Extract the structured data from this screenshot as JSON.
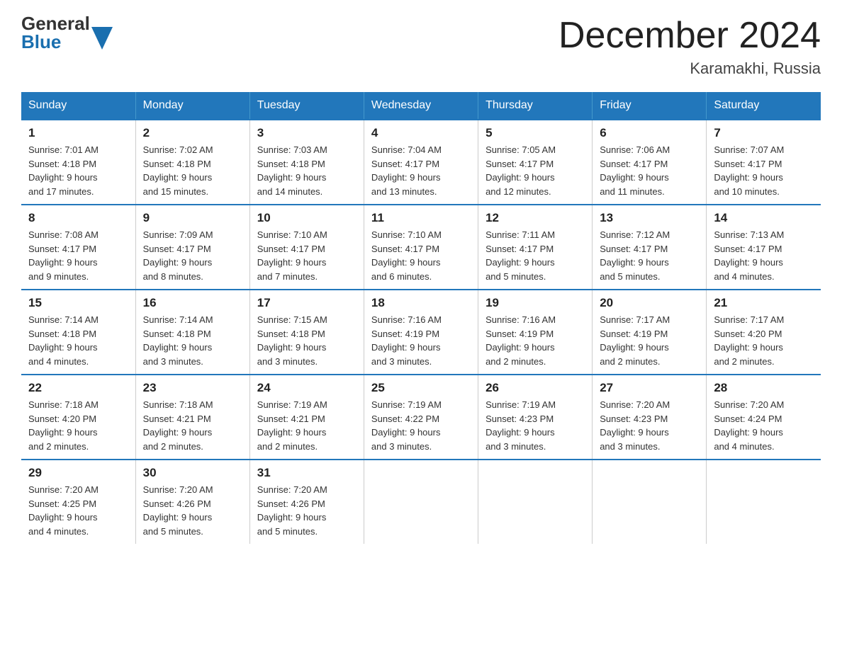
{
  "header": {
    "title": "December 2024",
    "subtitle": "Karamakhi, Russia",
    "logo_general": "General",
    "logo_blue": "Blue"
  },
  "days_of_week": [
    "Sunday",
    "Monday",
    "Tuesday",
    "Wednesday",
    "Thursday",
    "Friday",
    "Saturday"
  ],
  "weeks": [
    [
      {
        "num": "1",
        "sunrise": "7:01 AM",
        "sunset": "4:18 PM",
        "daylight": "9 hours and 17 minutes."
      },
      {
        "num": "2",
        "sunrise": "7:02 AM",
        "sunset": "4:18 PM",
        "daylight": "9 hours and 15 minutes."
      },
      {
        "num": "3",
        "sunrise": "7:03 AM",
        "sunset": "4:18 PM",
        "daylight": "9 hours and 14 minutes."
      },
      {
        "num": "4",
        "sunrise": "7:04 AM",
        "sunset": "4:17 PM",
        "daylight": "9 hours and 13 minutes."
      },
      {
        "num": "5",
        "sunrise": "7:05 AM",
        "sunset": "4:17 PM",
        "daylight": "9 hours and 12 minutes."
      },
      {
        "num": "6",
        "sunrise": "7:06 AM",
        "sunset": "4:17 PM",
        "daylight": "9 hours and 11 minutes."
      },
      {
        "num": "7",
        "sunrise": "7:07 AM",
        "sunset": "4:17 PM",
        "daylight": "9 hours and 10 minutes."
      }
    ],
    [
      {
        "num": "8",
        "sunrise": "7:08 AM",
        "sunset": "4:17 PM",
        "daylight": "9 hours and 9 minutes."
      },
      {
        "num": "9",
        "sunrise": "7:09 AM",
        "sunset": "4:17 PM",
        "daylight": "9 hours and 8 minutes."
      },
      {
        "num": "10",
        "sunrise": "7:10 AM",
        "sunset": "4:17 PM",
        "daylight": "9 hours and 7 minutes."
      },
      {
        "num": "11",
        "sunrise": "7:10 AM",
        "sunset": "4:17 PM",
        "daylight": "9 hours and 6 minutes."
      },
      {
        "num": "12",
        "sunrise": "7:11 AM",
        "sunset": "4:17 PM",
        "daylight": "9 hours and 5 minutes."
      },
      {
        "num": "13",
        "sunrise": "7:12 AM",
        "sunset": "4:17 PM",
        "daylight": "9 hours and 5 minutes."
      },
      {
        "num": "14",
        "sunrise": "7:13 AM",
        "sunset": "4:17 PM",
        "daylight": "9 hours and 4 minutes."
      }
    ],
    [
      {
        "num": "15",
        "sunrise": "7:14 AM",
        "sunset": "4:18 PM",
        "daylight": "9 hours and 4 minutes."
      },
      {
        "num": "16",
        "sunrise": "7:14 AM",
        "sunset": "4:18 PM",
        "daylight": "9 hours and 3 minutes."
      },
      {
        "num": "17",
        "sunrise": "7:15 AM",
        "sunset": "4:18 PM",
        "daylight": "9 hours and 3 minutes."
      },
      {
        "num": "18",
        "sunrise": "7:16 AM",
        "sunset": "4:19 PM",
        "daylight": "9 hours and 3 minutes."
      },
      {
        "num": "19",
        "sunrise": "7:16 AM",
        "sunset": "4:19 PM",
        "daylight": "9 hours and 2 minutes."
      },
      {
        "num": "20",
        "sunrise": "7:17 AM",
        "sunset": "4:19 PM",
        "daylight": "9 hours and 2 minutes."
      },
      {
        "num": "21",
        "sunrise": "7:17 AM",
        "sunset": "4:20 PM",
        "daylight": "9 hours and 2 minutes."
      }
    ],
    [
      {
        "num": "22",
        "sunrise": "7:18 AM",
        "sunset": "4:20 PM",
        "daylight": "9 hours and 2 minutes."
      },
      {
        "num": "23",
        "sunrise": "7:18 AM",
        "sunset": "4:21 PM",
        "daylight": "9 hours and 2 minutes."
      },
      {
        "num": "24",
        "sunrise": "7:19 AM",
        "sunset": "4:21 PM",
        "daylight": "9 hours and 2 minutes."
      },
      {
        "num": "25",
        "sunrise": "7:19 AM",
        "sunset": "4:22 PM",
        "daylight": "9 hours and 3 minutes."
      },
      {
        "num": "26",
        "sunrise": "7:19 AM",
        "sunset": "4:23 PM",
        "daylight": "9 hours and 3 minutes."
      },
      {
        "num": "27",
        "sunrise": "7:20 AM",
        "sunset": "4:23 PM",
        "daylight": "9 hours and 3 minutes."
      },
      {
        "num": "28",
        "sunrise": "7:20 AM",
        "sunset": "4:24 PM",
        "daylight": "9 hours and 4 minutes."
      }
    ],
    [
      {
        "num": "29",
        "sunrise": "7:20 AM",
        "sunset": "4:25 PM",
        "daylight": "9 hours and 4 minutes."
      },
      {
        "num": "30",
        "sunrise": "7:20 AM",
        "sunset": "4:26 PM",
        "daylight": "9 hours and 5 minutes."
      },
      {
        "num": "31",
        "sunrise": "7:20 AM",
        "sunset": "4:26 PM",
        "daylight": "9 hours and 5 minutes."
      },
      {
        "num": "",
        "sunrise": "",
        "sunset": "",
        "daylight": ""
      },
      {
        "num": "",
        "sunrise": "",
        "sunset": "",
        "daylight": ""
      },
      {
        "num": "",
        "sunrise": "",
        "sunset": "",
        "daylight": ""
      },
      {
        "num": "",
        "sunrise": "",
        "sunset": "",
        "daylight": ""
      }
    ]
  ],
  "labels": {
    "sunrise": "Sunrise: ",
    "sunset": "Sunset: ",
    "daylight": "Daylight: "
  }
}
